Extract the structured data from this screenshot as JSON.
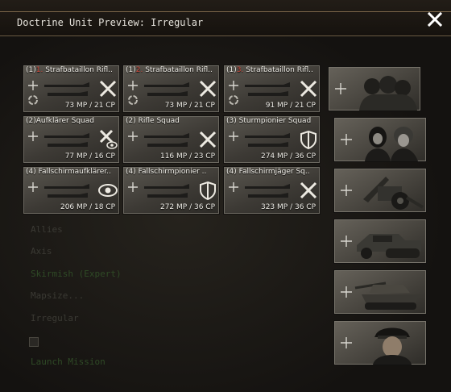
{
  "window": {
    "title": "Doctrine Unit Preview: Irregular",
    "close_icon": "close-icon"
  },
  "background_text": [
    {
      "text": "Allies",
      "green": false
    },
    {
      "text": "Axis",
      "green": false
    },
    {
      "text": "Skirmish (Expert)",
      "green": true
    },
    {
      "text": "Mapsize...",
      "green": false
    },
    {
      "text": "Irregular",
      "green": false
    },
    {
      "text": "Launch Mission",
      "green": true
    }
  ],
  "units": [
    {
      "count": "(1)",
      "num": "1.",
      "name": "Strafbataillon Rifl..",
      "cost": "73 MP / 21 CP",
      "icon": "crossed-weapons-icon"
    },
    {
      "count": "(1)",
      "num": "2.",
      "name": "Strafbataillon Rifl..",
      "cost": "73 MP / 21 CP",
      "icon": "crossed-weapons-icon"
    },
    {
      "count": "(1)",
      "num": "3.",
      "name": "Strafbataillon Rifl..",
      "cost": "91 MP / 21 CP",
      "icon": "crossed-weapons-icon"
    },
    {
      "count": "(2)",
      "num": "",
      "name": "Aufklärer Squad",
      "cost": "77 MP / 16 CP",
      "icon": "crossed-weapons-eye-icon"
    },
    {
      "count": "(2)",
      "num": "",
      "name": "Rifle Squad",
      "cost": "116 MP / 23 CP",
      "icon": "crossed-weapons-icon"
    },
    {
      "count": "(3)",
      "num": "",
      "name": "Sturmpionier Squad",
      "cost": "274 MP / 36 CP",
      "icon": "shield-icon"
    },
    {
      "count": "(4)",
      "num": "",
      "name": "Fallschirmaufklärer..",
      "cost": "206 MP / 18 CP",
      "icon": "eye-icon"
    },
    {
      "count": "(4)",
      "num": "",
      "name": "Fallschirmpionier ..",
      "cost": "272 MP / 36 CP",
      "icon": "shield-icon"
    },
    {
      "count": "(4)",
      "num": "",
      "name": "Fallschirmjäger Sq..",
      "cost": "323 MP / 36 CP",
      "icon": "crossed-weapons-icon"
    }
  ],
  "portraits": [
    {
      "icon": "infantry-group-portrait"
    },
    {
      "icon": "two-soldiers-portrait"
    },
    {
      "icon": "artillery-gun-portrait"
    },
    {
      "icon": "halftrack-portrait"
    },
    {
      "icon": "tank-destroyer-portrait"
    },
    {
      "icon": "officer-portrait"
    }
  ]
}
